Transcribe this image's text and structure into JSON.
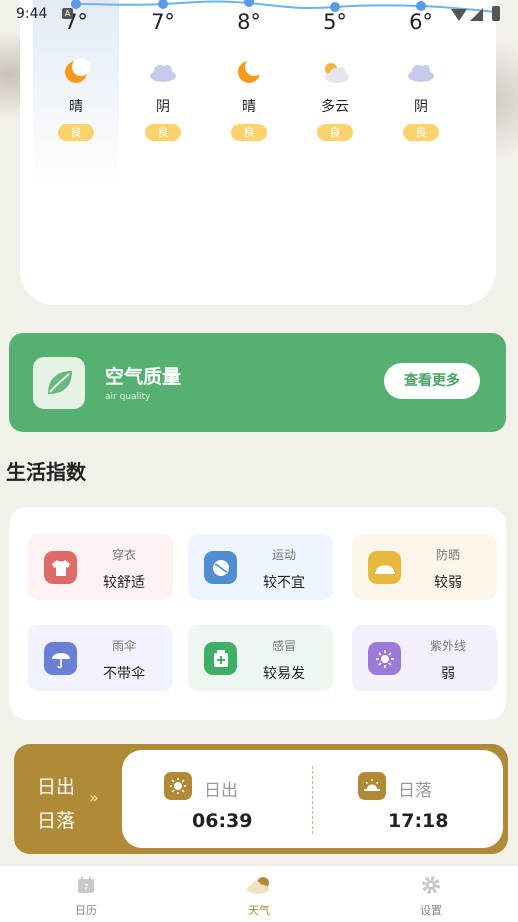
{
  "status_bar": {
    "time": "9:44",
    "notification_badge": "A"
  },
  "forecast": {
    "days": [
      {
        "temp": "7°",
        "icon": "moon-icon",
        "weather": "晴",
        "air_quality": "良"
      },
      {
        "temp": "7°",
        "icon": "cloud-icon",
        "weather": "阴",
        "air_quality": "良"
      },
      {
        "temp": "8°",
        "icon": "moon-icon",
        "weather": "晴",
        "air_quality": "良"
      },
      {
        "temp": "5°",
        "icon": "partly-cloudy-icon",
        "weather": "多云",
        "air_quality": "良"
      },
      {
        "temp": "6°",
        "icon": "cloud-icon",
        "weather": "阴",
        "air_quality": "良"
      }
    ]
  },
  "air_quality": {
    "title": "空气质量",
    "subtitle": "air quality",
    "more_label": "查看更多"
  },
  "life_index": {
    "title": "生活指数",
    "items": [
      {
        "label": "穿衣",
        "value": "较舒适",
        "icon": "clothing-icon",
        "color": "#e06a6a",
        "bg": "#fdf2f2"
      },
      {
        "label": "运动",
        "value": "较不宜",
        "icon": "sport-icon",
        "color": "#4f8fd1",
        "bg": "#eef5fd"
      },
      {
        "label": "防晒",
        "value": "较弱",
        "icon": "sunscreen-icon",
        "color": "#e8b93d",
        "bg": "#fbf6e9"
      },
      {
        "label": "雨伞",
        "value": "不带伞",
        "icon": "umbrella-icon",
        "color": "#6b7fd6",
        "bg": "#f1f3fc"
      },
      {
        "label": "感冒",
        "value": "较易发",
        "icon": "medicine-icon",
        "color": "#3fae67",
        "bg": "#edf7f0"
      },
      {
        "label": "紫外线",
        "value": "弱",
        "icon": "uv-icon",
        "color": "#9b7ad9",
        "bg": "#f3effb"
      }
    ]
  },
  "sun": {
    "side_line1": "日出",
    "side_line2": "日落",
    "sunrise_label": "日出",
    "sunrise_time": "06:39",
    "sunset_label": "日落",
    "sunset_time": "17:18"
  },
  "tabs": [
    {
      "label": "日历",
      "icon": "calendar-icon",
      "active": false
    },
    {
      "label": "天气",
      "icon": "weather-icon",
      "active": true
    },
    {
      "label": "设置",
      "icon": "gear-icon",
      "active": false
    }
  ],
  "colors": {
    "accent": "#b08a36",
    "air_green": "#56b072",
    "aq_badge": "#fad36c",
    "trend_line": "#6ab4ec"
  }
}
